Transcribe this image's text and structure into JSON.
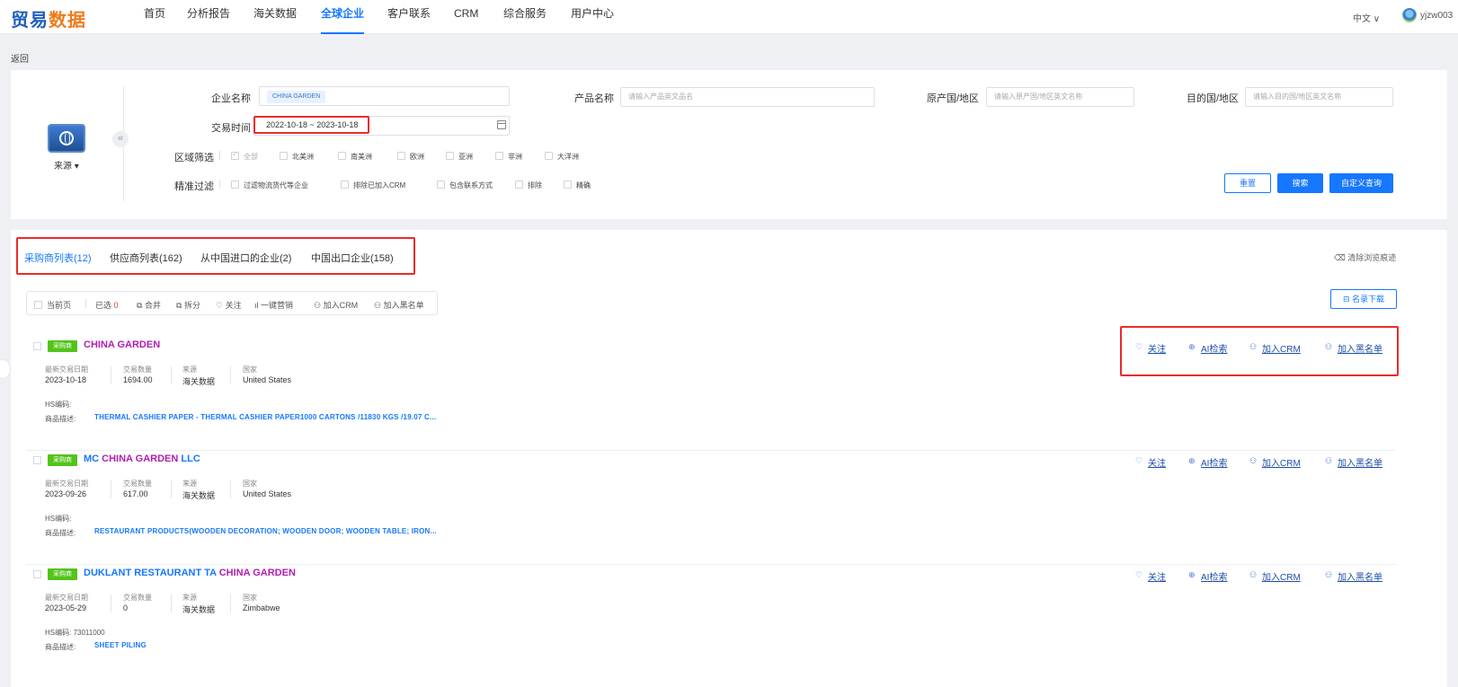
{
  "nav": {
    "logo_part1": "贸易",
    "logo_part2": "数据",
    "items": [
      "首页",
      "分析报告",
      "海关数据",
      "全球企业",
      "客户联系",
      "CRM",
      "综合服务",
      "用户中心"
    ],
    "active_index": 3,
    "language": "中文 ∨",
    "username": "yjzw003"
  },
  "back_label": "返回",
  "filters": {
    "source_label": "来源 ▾",
    "collapse_icon": "«",
    "company_name_label": "企业名称",
    "company_tag": "CHINA GARDEN",
    "product_name_label": "产品名称",
    "product_placeholder": "请输入产品英文品名",
    "origin_label": "原产国/地区",
    "origin_placeholder": "请输入原产国/地区英文名称",
    "destination_label": "目的国/地区",
    "destination_placeholder": "请输入目的国/地区英文名称",
    "trade_time_label": "交易时间",
    "trade_time_value": "2022-10-18 ~ 2023-10-18",
    "region_label": "区域筛选",
    "regions": [
      "全部",
      "北美洲",
      "南美洲",
      "欧洲",
      "亚洲",
      "非洲",
      "大洋洲"
    ],
    "precise_label": "精准过滤",
    "precise_options": [
      "过滤物流货代等企业",
      "排除已加入CRM",
      "包含联系方式",
      "排除",
      "精确"
    ],
    "reset_button": "重置",
    "search_button": "搜索",
    "custom_query_button": "自定义查询"
  },
  "tabs": [
    "采购商列表(12)",
    "供应商列表(162)",
    "从中国进口的企业(2)",
    "中国出口企业(158)"
  ],
  "active_tab": 0,
  "clear_history": "清除浏览痕迹",
  "toolbar": {
    "current_page": "当前页",
    "selected_label": "已选",
    "selected_count": "0",
    "merge": "合并",
    "split": "拆分",
    "follow": "关注",
    "one_click_marketing": "一键营销",
    "add_crm": "加入CRM",
    "add_blacklist": "加入黑名单",
    "download": "名录下载"
  },
  "meta_labels": {
    "last_trade_date": "最新交易日期",
    "trade_count": "交易数量",
    "source": "来源",
    "country": "国家",
    "hs_code": "HS编码:",
    "description": "商品描述:"
  },
  "actions": {
    "follow": "关注",
    "ai_search": "AI检索",
    "add_crm": "加入CRM",
    "add_blacklist": "加入黑名单"
  },
  "records": [
    {
      "badge": "采购商",
      "name_prefix": "",
      "name_highlight": "CHINA GARDEN",
      "name_suffix": "",
      "last_trade_date": "2023-10-18",
      "trade_count": "1694.00",
      "source": "海关数据",
      "country": "United States",
      "hs_code": "",
      "description": "THERMAL CASHIER PAPER - THERMAL CASHIER PAPER1000 CARTONS /11830 KGS /19.07 C..."
    },
    {
      "badge": "采购商",
      "name_prefix": "MC ",
      "name_highlight": "CHINA GARDEN",
      "name_suffix": " LLC",
      "last_trade_date": "2023-09-26",
      "trade_count": "617.00",
      "source": "海关数据",
      "country": "United States",
      "hs_code": "",
      "description": "RESTAURANT PRODUCTS(WOODEN DECORATION; WOODEN DOOR; WOODEN TABLE; IRON..."
    },
    {
      "badge": "采购商",
      "name_prefix": "DUKLANT RESTAURANT TA ",
      "name_highlight": "CHINA GARDEN",
      "name_suffix": "",
      "last_trade_date": "2023-05-29",
      "trade_count": "0",
      "source": "海关数据",
      "country": "Zimbabwe",
      "hs_code": "73011000",
      "description": "SHEET PILING"
    }
  ]
}
